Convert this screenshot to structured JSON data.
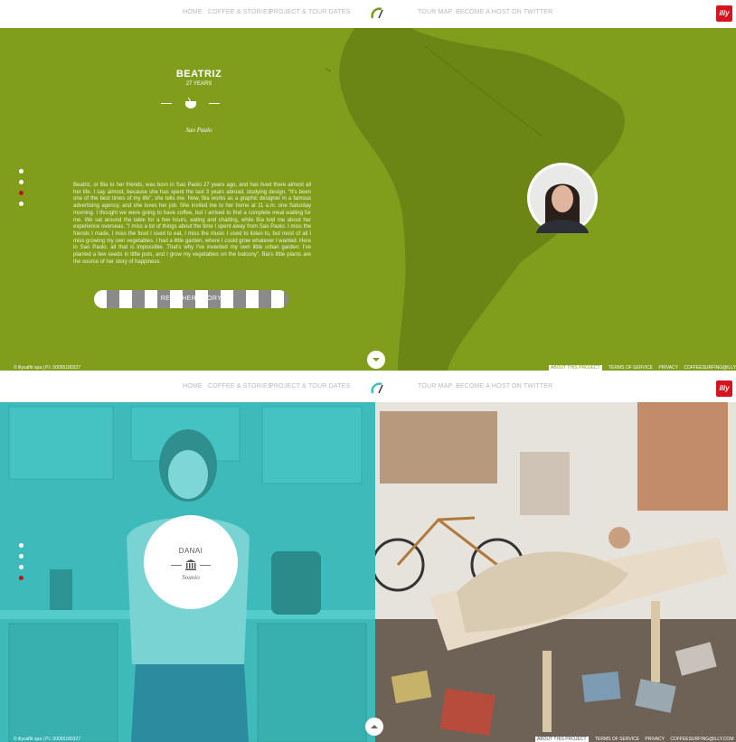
{
  "nav": {
    "left": [
      "HOME",
      "COFFEE & STORIES",
      "PROJECT & TOUR DATES"
    ],
    "right": [
      "TOUR MAP",
      "BECOME A HOST",
      "ON TWITTER"
    ],
    "brand": "illy"
  },
  "story1": {
    "name": "BEATRIZ",
    "age": "27 YEARS",
    "city": "Sao Paulo",
    "text": "Beatriz, or Bia to her friends, was born in Sao Paolo 27 years ago, and has lived there almost all her life. I say almost, because she has spent the last 3 years abroad, studying design. \"It's been one of the best times of my life\", she tells me. Now, Bia works as a graphic designer in a famous advertising agency, and she loves her job. She invited me to her home at 11 a.m. one Saturday morning. I thought we were going to have coffee, but I arrived to find a complete meal waiting for me. We sat around the table for a few hours, eating and chatting, while Bia told me about her experience overseas. \"I miss a lot of things about the time I spent away from Sao Paolo. I miss the friends I made, I miss the food I used to eat, I miss the music I used to listen to, but most of all I miss growing my own vegetables. I had a little garden, where I could grow whatever I wanted. Here in Sao Paolo, all that is impossible. That's why I've invented my own little urban garden: I've planted a few seeds in little pots, and I grow my vegetables on the balcony\". Bia's little plants are the source of her story of happiness.",
    "button": "READ HER STORY",
    "dot_count": 4,
    "active_dot": 3
  },
  "story2": {
    "name": "DANAI",
    "city": "Sounio",
    "dot_count": 4,
    "active_dot": 4
  },
  "footer": {
    "copyright": "© illycaffè spa | P.I. 00055180327",
    "links": [
      "ABOUT THIS PROJECT",
      "TERMS OF SERVICE",
      "PRIVACY",
      "COFFEESURFING@ILLY.COM"
    ]
  },
  "colors": {
    "green": "#819d1c",
    "teal": "#3fbcbc",
    "red": "#d5141f"
  },
  "icons": [
    "coffee-cup-icon",
    "temple-icon",
    "chevron-down-icon",
    "chevron-up-icon"
  ]
}
